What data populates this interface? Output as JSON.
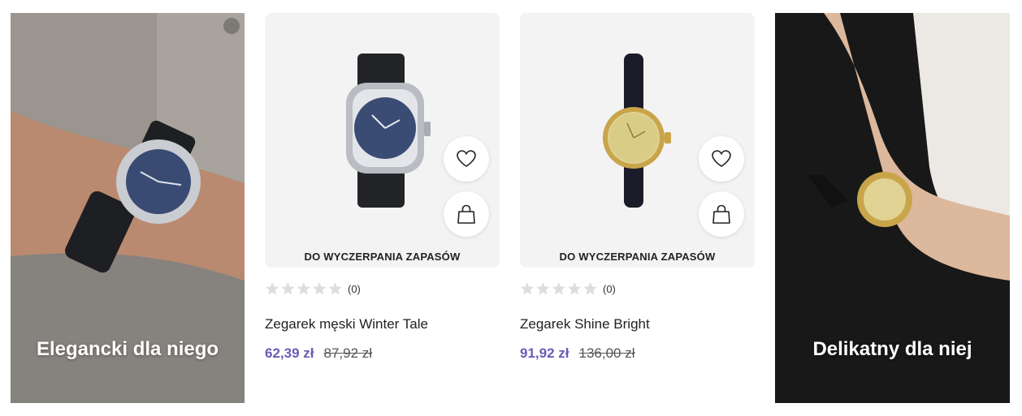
{
  "promos": {
    "left": {
      "title": "Elegancki dla niego"
    },
    "right": {
      "title": "Delikatny dla niej"
    }
  },
  "products": [
    {
      "name": "Zegarek męski Winter Tale",
      "stock_label": "DO WYCZERPANIA ZAPASÓW",
      "rating": 0,
      "review_count": "(0)",
      "price_current": "62,39 zł",
      "price_old": "87,92 zł",
      "icons": {
        "favorite": "heart-icon",
        "cart": "shopping-bag-icon"
      }
    },
    {
      "name": "Zegarek Shine Bright",
      "stock_label": "DO WYCZERPANIA ZAPASÓW",
      "rating": 0,
      "review_count": "(0)",
      "price_current": "91,92 zł",
      "price_old": "136,00 zł",
      "icons": {
        "favorite": "heart-icon",
        "cart": "shopping-bag-icon"
      }
    }
  ],
  "colors": {
    "price_accent": "#6b5bb5",
    "star_empty": "#dddddd",
    "card_bg": "#f3f3f3"
  }
}
